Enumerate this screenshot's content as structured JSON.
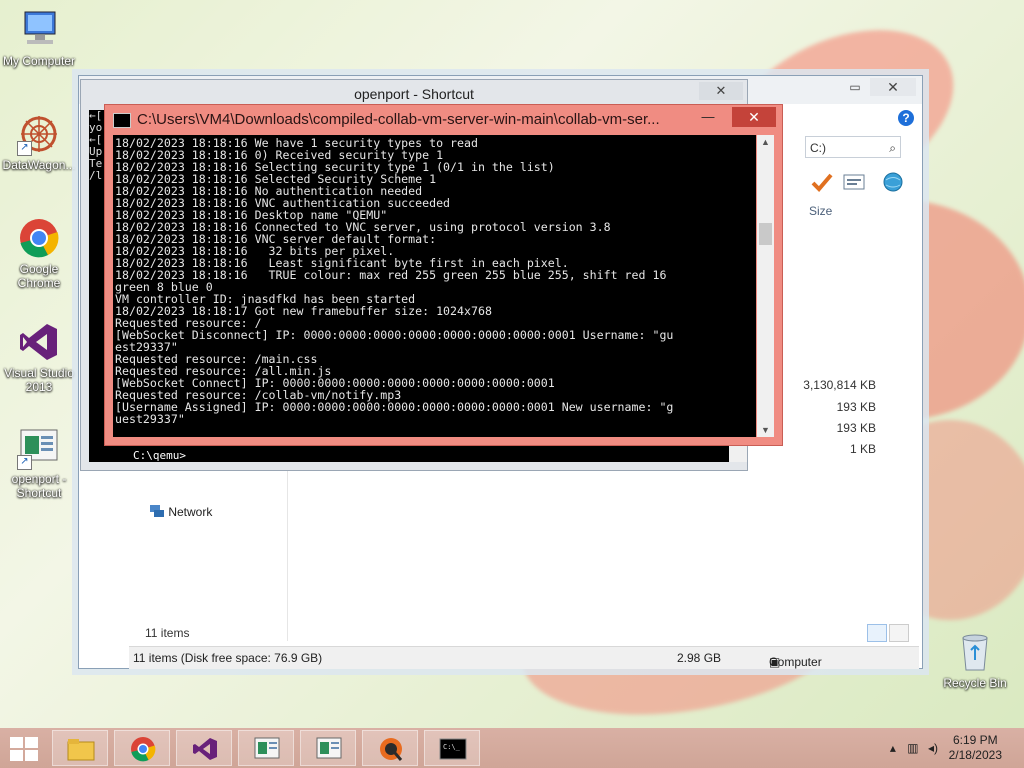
{
  "desktop": {
    "icons": [
      {
        "label": "My Computer"
      },
      {
        "label": "DataWagon..."
      },
      {
        "label": "Google Chrome"
      },
      {
        "label": "Visual Studio 2013"
      },
      {
        "label": "openport - Shortcut"
      },
      {
        "label": "Recycle Bin"
      }
    ]
  },
  "explorer": {
    "search_placeholder": "C:)",
    "help_glyph": "?",
    "size_header": "Size",
    "sizes": [
      "3,130,814 KB",
      "193 KB",
      "193 KB",
      "1 KB"
    ],
    "nav_network": "Network",
    "items_count": "11 items",
    "status_left": "11 items (Disk free space: 76.9 GB)",
    "status_mid": "2.98 GB",
    "status_right": "Computer"
  },
  "console_back": {
    "title": "openport - Shortcut",
    "left_fragments": "←[\nyo\n←[\nUp\nTe\n/l",
    "prompt": "C:\\qemu>"
  },
  "console": {
    "title": "C:\\Users\\VM4\\Downloads\\compiled-collab-vm-server-win-main\\collab-vm-ser...",
    "lines": [
      "18/02/2023 18:18:16 We have 1 security types to read",
      "18/02/2023 18:18:16 0) Received security type 1",
      "18/02/2023 18:18:16 Selecting security type 1 (0/1 in the list)",
      "18/02/2023 18:18:16 Selected Security Scheme 1",
      "18/02/2023 18:18:16 No authentication needed",
      "18/02/2023 18:18:16 VNC authentication succeeded",
      "18/02/2023 18:18:16 Desktop name \"QEMU\"",
      "18/02/2023 18:18:16 Connected to VNC server, using protocol version 3.8",
      "18/02/2023 18:18:16 VNC server default format:",
      "18/02/2023 18:18:16   32 bits per pixel.",
      "18/02/2023 18:18:16   Least significant byte first in each pixel.",
      "18/02/2023 18:18:16   TRUE colour: max red 255 green 255 blue 255, shift red 16",
      "green 8 blue 0",
      "VM controller ID: jnasdfkd has been started",
      "18/02/2023 18:18:17 Got new framebuffer size: 1024x768",
      "Requested resource: /",
      "[WebSocket Disconnect] IP: 0000:0000:0000:0000:0000:0000:0000:0001 Username: \"gu",
      "est29337\"",
      "Requested resource: /main.css",
      "Requested resource: /all.min.js",
      "[WebSocket Connect] IP: 0000:0000:0000:0000:0000:0000:0000:0001",
      "Requested resource: /collab-vm/notify.mp3",
      "[Username Assigned] IP: 0000:0000:0000:0000:0000:0000:0000:0001 New username: \"g",
      "uest29337\"",
      "_"
    ]
  },
  "taskbar": {
    "time": "6:19 PM",
    "date": "2/18/2023"
  },
  "colors": {
    "console_frame": "#f08c82",
    "console_close": "#c4433a",
    "taskbar": "#d4aa9d"
  }
}
